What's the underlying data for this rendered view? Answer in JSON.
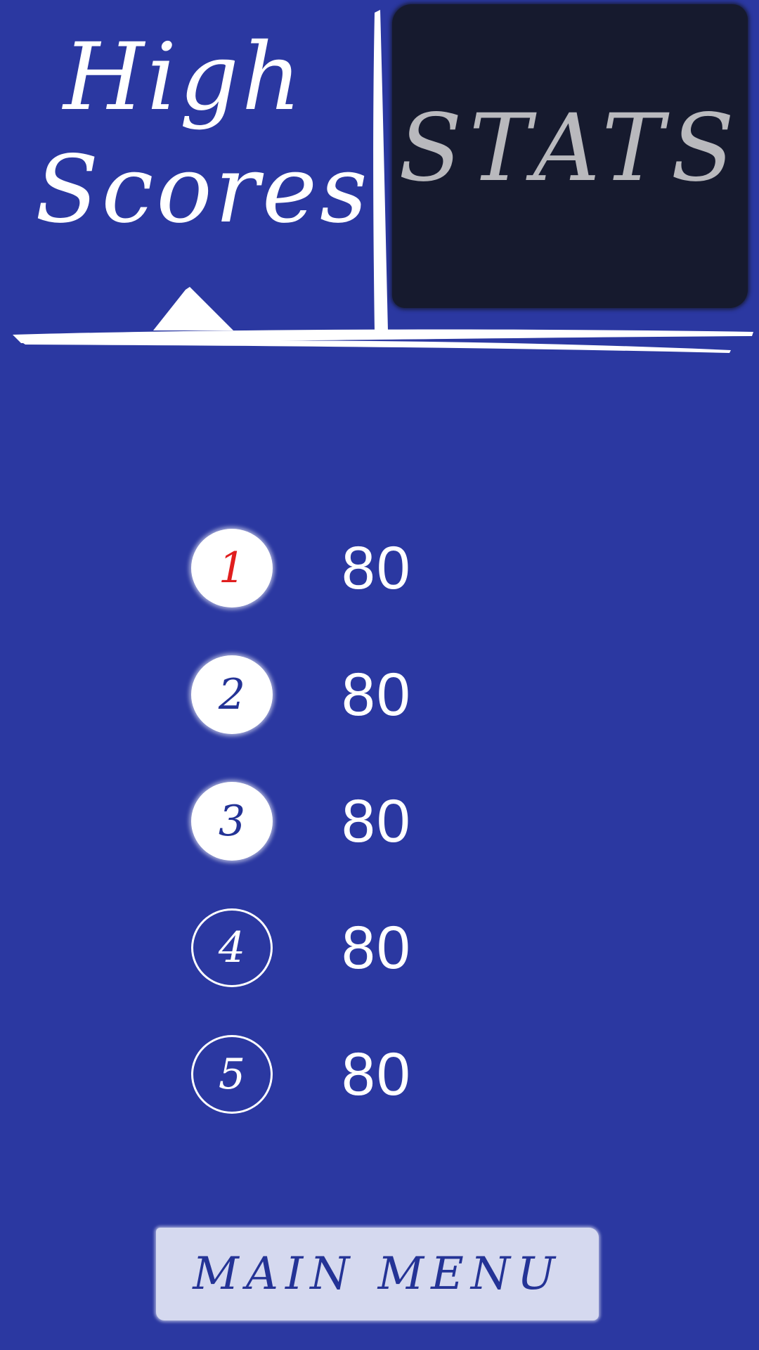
{
  "tabs": {
    "high_scores": {
      "line1": "High",
      "line2": "Scores",
      "selected": true
    },
    "stats": {
      "label": "STATS",
      "selected": false
    }
  },
  "scores": [
    {
      "rank": "1",
      "value": "80",
      "style": "filled-first"
    },
    {
      "rank": "2",
      "value": "80",
      "style": "filled"
    },
    {
      "rank": "3",
      "value": "80",
      "style": "filled"
    },
    {
      "rank": "4",
      "value": "80",
      "style": "outline"
    },
    {
      "rank": "5",
      "value": "80",
      "style": "outline"
    }
  ],
  "main_menu": {
    "label": "MAIN MENU"
  },
  "colors": {
    "background": "#2b38a1",
    "stats_tab": "#161a2e",
    "stats_text": "#b9b9bd",
    "first_rank": "#e01e1e",
    "badge_text": "#243396",
    "button_bg": "#d5d9ef"
  }
}
